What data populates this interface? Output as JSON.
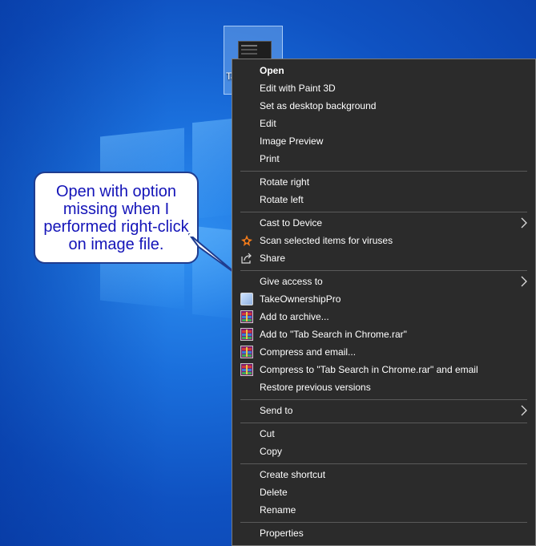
{
  "desktop": {
    "file_label": "Ta"
  },
  "callout": {
    "text": "Open with option missing when I performed right-click on image file."
  },
  "context_menu": {
    "items": [
      {
        "label": "Open"
      },
      {
        "label": "Edit with Paint 3D"
      },
      {
        "label": "Set as desktop background"
      },
      {
        "label": "Edit"
      },
      {
        "label": "Image Preview"
      },
      {
        "label": "Print"
      },
      {
        "label": "Rotate right"
      },
      {
        "label": "Rotate left"
      },
      {
        "label": "Cast to Device"
      },
      {
        "label": "Scan selected items for viruses"
      },
      {
        "label": "Share"
      },
      {
        "label": "Give access to"
      },
      {
        "label": "TakeOwnershipPro"
      },
      {
        "label": "Add to archive..."
      },
      {
        "label": "Add to \"Tab Search in Chrome.rar\""
      },
      {
        "label": "Compress and email..."
      },
      {
        "label": "Compress to \"Tab Search in Chrome.rar\" and email"
      },
      {
        "label": "Restore previous versions"
      },
      {
        "label": "Send to"
      },
      {
        "label": "Cut"
      },
      {
        "label": "Copy"
      },
      {
        "label": "Create shortcut"
      },
      {
        "label": "Delete"
      },
      {
        "label": "Rename"
      },
      {
        "label": "Properties"
      }
    ]
  },
  "colors": {
    "menu_background": "#2b2b2b",
    "menu_text": "#ffffff",
    "separator": "#5a5a5a",
    "callout_text": "#1414b8",
    "callout_border": "#1f3c8f",
    "desktop_blue": "#1a6fdc"
  }
}
